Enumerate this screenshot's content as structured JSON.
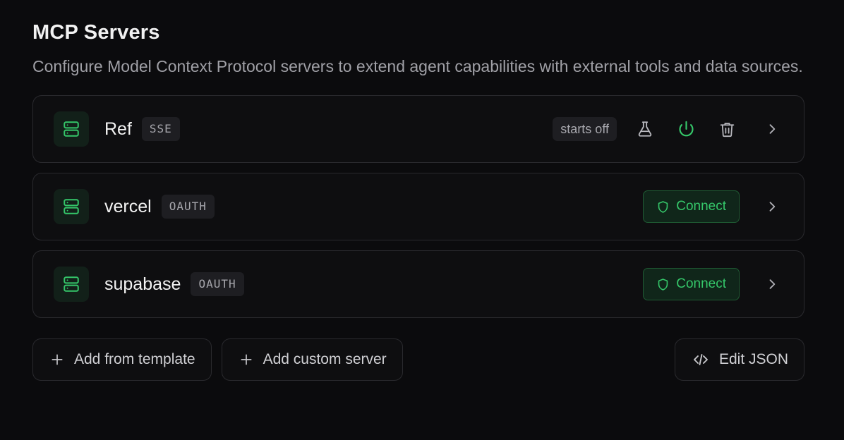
{
  "header": {
    "title": "MCP Servers",
    "description": "Configure Model Context Protocol servers to extend agent capabilities with external tools and data sources."
  },
  "servers": [
    {
      "name": "Ref",
      "transport": "SSE",
      "status": "starts off",
      "icons": [
        "server-icon",
        "flask-icon",
        "power-icon",
        "trash-icon",
        "chevron-right-icon"
      ]
    },
    {
      "name": "vercel",
      "transport": "OAUTH",
      "connect_label": "Connect",
      "icons": [
        "server-icon",
        "shield-icon",
        "chevron-right-icon"
      ]
    },
    {
      "name": "supabase",
      "transport": "OAUTH",
      "connect_label": "Connect",
      "icons": [
        "server-icon",
        "shield-icon",
        "chevron-right-icon"
      ]
    }
  ],
  "actions": {
    "add_template_label": "Add from template",
    "add_custom_label": "Add custom server",
    "edit_json_label": "Edit JSON"
  },
  "colors": {
    "background": "#0b0b0d",
    "accent_green": "#35c76a",
    "card_border": "#2a2a2e"
  }
}
